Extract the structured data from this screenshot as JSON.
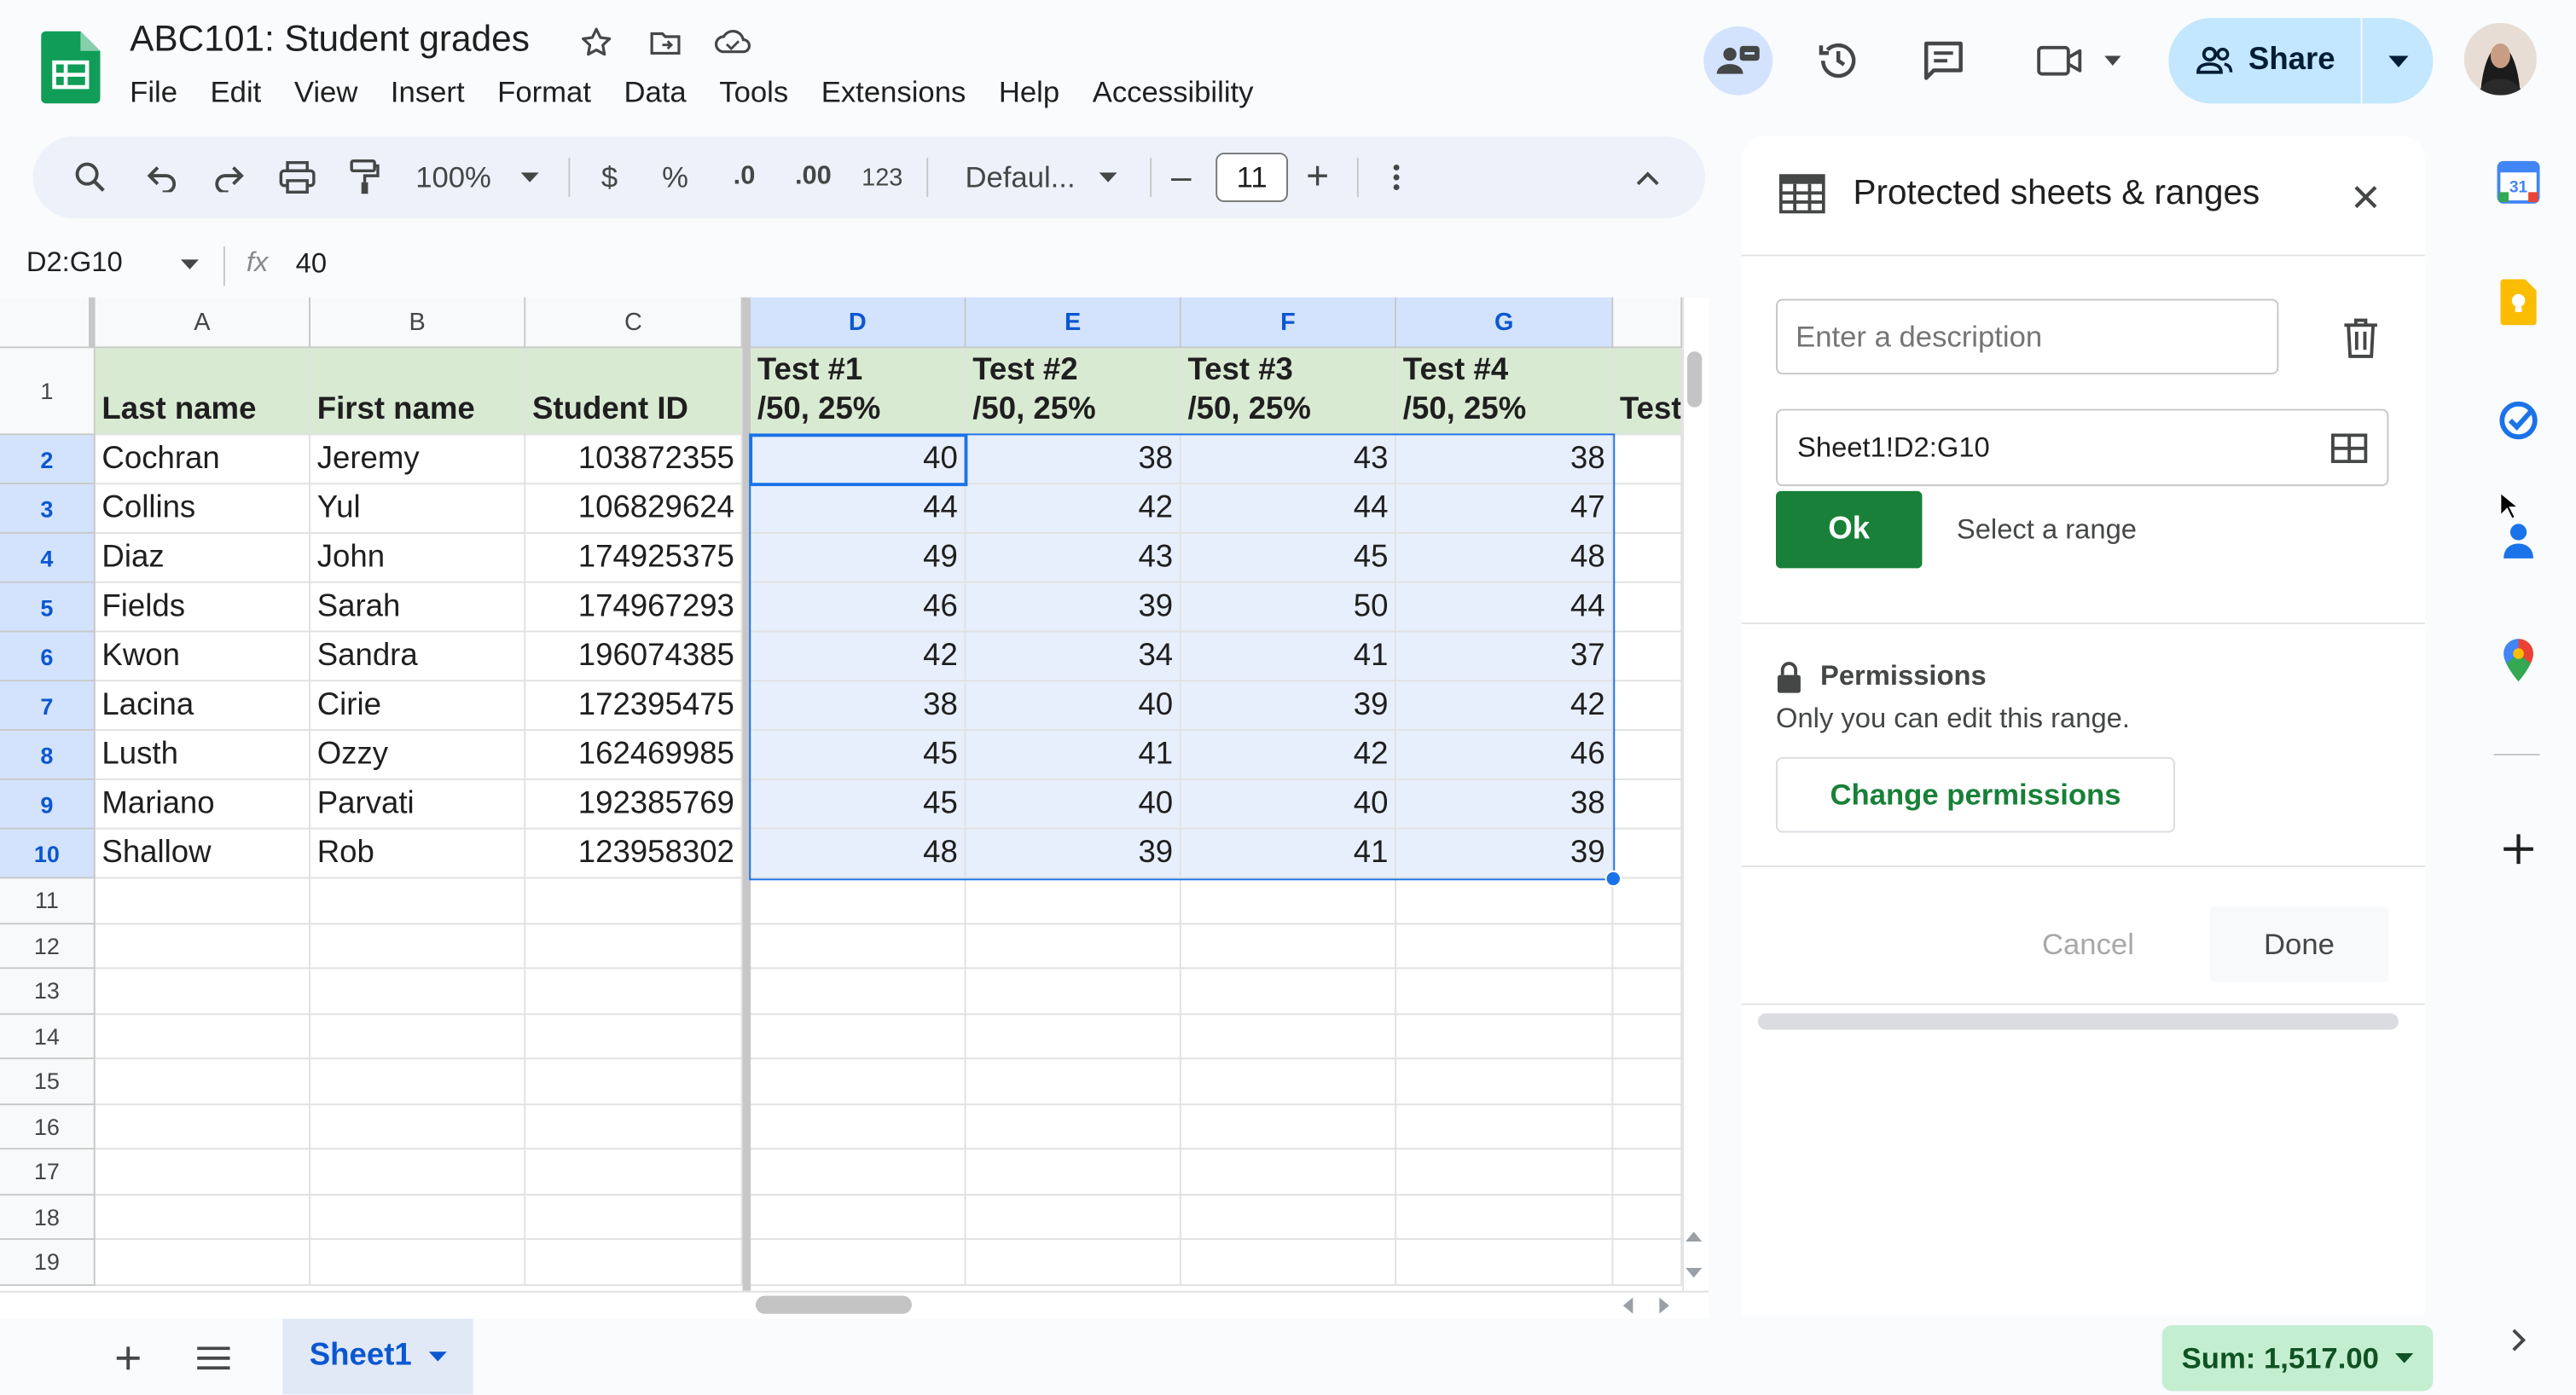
{
  "app": {
    "title": "ABC101: Student grades",
    "menu": [
      "File",
      "Edit",
      "View",
      "Insert",
      "Format",
      "Data",
      "Tools",
      "Extensions",
      "Help",
      "Accessibility"
    ],
    "share_label": "Share"
  },
  "toolbar": {
    "zoom": "100%",
    "currency": "$",
    "percent": "%",
    "dec_decrease": ".0",
    "dec_increase": ".00",
    "number_format": "123",
    "font": "Defaul...",
    "font_size": "11",
    "minus": "–",
    "plus": "+"
  },
  "formula_bar": {
    "name_box": "D2:G10",
    "fx": "fx",
    "value": "40"
  },
  "grid": {
    "columns": [
      "A",
      "B",
      "C",
      "D",
      "E",
      "F",
      "G"
    ],
    "header_row": [
      "Last name",
      "First name",
      "Student ID",
      "Test #1\n/50, 25%",
      "Test #2\n/50, 25%",
      "Test #3\n/50, 25%",
      "Test #4\n/50, 25%"
    ],
    "partial_header": "Test",
    "row_numbers": [
      "1",
      "2",
      "3",
      "4",
      "5",
      "6",
      "7",
      "8",
      "9",
      "10",
      "11",
      "12",
      "13",
      "14",
      "15",
      "16",
      "17",
      "18",
      "19"
    ],
    "rows": [
      [
        "Cochran",
        "Jeremy",
        "103872355",
        "40",
        "38",
        "43",
        "38"
      ],
      [
        "Collins",
        "Yul",
        "106829624",
        "44",
        "42",
        "44",
        "47"
      ],
      [
        "Diaz",
        "John",
        "174925375",
        "49",
        "43",
        "45",
        "48"
      ],
      [
        "Fields",
        "Sarah",
        "174967293",
        "46",
        "39",
        "50",
        "44"
      ],
      [
        "Kwon",
        "Sandra",
        "196074385",
        "42",
        "34",
        "41",
        "37"
      ],
      [
        "Lacina",
        "Cirie",
        "172395475",
        "38",
        "40",
        "39",
        "42"
      ],
      [
        "Lusth",
        "Ozzy",
        "162469985",
        "45",
        "41",
        "42",
        "46"
      ],
      [
        "Mariano",
        "Parvati",
        "192385769",
        "45",
        "40",
        "40",
        "38"
      ],
      [
        "Shallow",
        "Rob",
        "123958302",
        "48",
        "39",
        "41",
        "39"
      ]
    ]
  },
  "bottom": {
    "sheet_tab": "Sheet1",
    "sum": "Sum: 1,517.00"
  },
  "panel": {
    "title": "Protected sheets & ranges",
    "description_placeholder": "Enter a description",
    "range_value": "Sheet1!D2:G10",
    "ok_label": "Ok",
    "select_range": "Select a range",
    "permissions_title": "Permissions",
    "permissions_desc": "Only you can edit this range.",
    "change_permissions": "Change permissions",
    "cancel": "Cancel",
    "done": "Done"
  },
  "colors": {
    "accent": "#1a73e8",
    "header_fill": "#d9ead3",
    "selection_fill": "#e8effc",
    "ok_green": "#188038",
    "share_fill": "#c2e7ff",
    "sum_fill": "#c4eed0"
  },
  "icons": [
    "sheets-logo-icon",
    "star-icon",
    "move-folder-icon",
    "cloud-saved-icon",
    "meeting-chat-icon",
    "version-history-icon",
    "comments-icon",
    "meet-camera-icon",
    "people-icon",
    "search-icon",
    "undo-icon",
    "redo-icon",
    "print-icon",
    "paint-format-icon",
    "more-vert-icon",
    "collapse-icon",
    "table-icon",
    "close-icon",
    "trash-icon",
    "grid-select-icon",
    "lock-icon",
    "calendar-icon",
    "keep-icon",
    "tasks-icon",
    "contacts-icon",
    "maps-icon",
    "add-icon",
    "chevron-right-icon",
    "all-sheets-icon"
  ]
}
